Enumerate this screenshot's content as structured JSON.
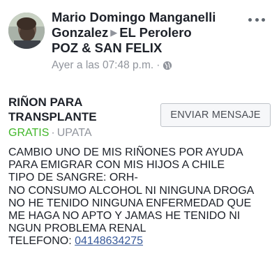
{
  "header": {
    "author": "Mario Domingo Manganelli Gonzalez",
    "author_line1": "Mario Domingo Manganelli",
    "author_line2": "Gonzalez",
    "group_line1": "EL Perolero",
    "group_line2": "POZ & SAN FELIX",
    "timestamp": "Ayer a las 07:48 p.m.",
    "separator": "·",
    "audience_icon": "globe-icon",
    "more_icon": "more-options-icon",
    "arrow_icon": "triangle-right-icon"
  },
  "listing": {
    "title": "RIÑON PARA TRANSPLANTE",
    "title_line1": "RIÑON PARA",
    "title_line2": "TRANSPLANTE",
    "price": "GRATIS",
    "separator": "·",
    "location": "UPATA",
    "message_button": "ENVIAR MENSAJE"
  },
  "body": {
    "lines": [
      "CAMBIO UNO DE MIS RIÑONES POR AYUDA",
      "PARA EMIGRAR CON MIS HIJOS A CHILE",
      "TIPO DE SANGRE: ORH-",
      "NO CONSUMO ALCOHOL NI NINGUNA DROGA",
      "NO HE TENIDO NINGUNA ENFERMEDAD QUE",
      "ME HAGA NO APTO Y JAMAS HE TENIDO NI",
      "NGUN PROBLEMA RENAL"
    ],
    "phone_label": "TELEFONO: ",
    "phone_number": "04148634275"
  },
  "colors": {
    "price": "#42b72a",
    "link": "#365899",
    "meta": "#90949c",
    "text": "#1d2129"
  }
}
